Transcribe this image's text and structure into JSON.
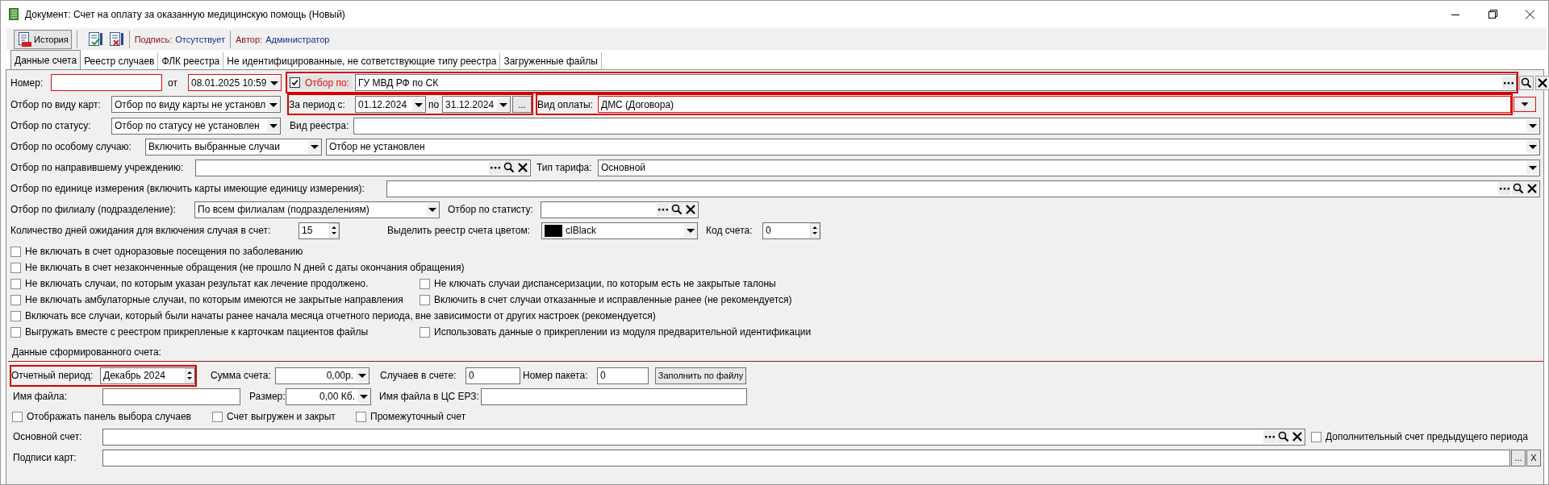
{
  "window": {
    "title": "Документ: Счет на оплату за оказанную медицинскую помощь (Новый)"
  },
  "toolbar": {
    "history_button": "История",
    "signature": {
      "label": "Подпись:",
      "value": "Отсутствует"
    },
    "author": {
      "label": "Автор:",
      "value": "Администратор"
    }
  },
  "tabs": [
    {
      "label": "Данные счета",
      "selected": true
    },
    {
      "label": "Реестр случаев",
      "selected": false
    },
    {
      "label": "ФЛК реестра",
      "selected": false
    },
    {
      "label": "Не идентифицированные, не сответствующие типу реестра",
      "selected": false
    },
    {
      "label": "Загруженные файлы",
      "selected": false
    }
  ],
  "rows": [
    [
      {
        "kind": "label",
        "text": "Номер:"
      },
      {
        "kind": "input",
        "highlighted": true
      },
      {
        "kind": "label",
        "text": "от"
      },
      {
        "kind": "date",
        "value": "08.01.2025 10:59",
        "highlighted": true
      },
      {
        "kind": "group",
        "highlighted": true,
        "items": [
          {
            "kind": "filter-check",
            "label": "Отбор по:",
            "checked": true
          },
          {
            "kind": "picker",
            "value": "ГУ МВД РФ по СК"
          }
        ]
      },
      {
        "kind": "icon-buttons"
      }
    ],
    [
      {
        "kind": "label",
        "text": "Отбор по виду карт:"
      },
      {
        "kind": "combo",
        "value": "Отбор по виду карты не установл"
      },
      {
        "kind": "group",
        "highlighted": true,
        "items": [
          {
            "kind": "label",
            "text": "За период с:"
          },
          {
            "kind": "date",
            "value": "01.12.2024"
          },
          {
            "kind": "label",
            "text": "по"
          },
          {
            "kind": "date",
            "value": "31.12.2024"
          },
          {
            "kind": "button",
            "label": "..."
          }
        ]
      },
      {
        "kind": "group",
        "highlighted": true,
        "items": [
          {
            "kind": "label",
            "text": "Вид оплаты:"
          },
          {
            "kind": "text",
            "value": "ДМС (Договора)",
            "highlighted": true
          }
        ]
      },
      {
        "kind": "arrow"
      }
    ],
    [
      {
        "kind": "label",
        "text": "Отбор по статусу:"
      },
      {
        "kind": "combo",
        "value": "Отбор по статусу не установлен"
      },
      {
        "kind": "label",
        "text": "Вид реестра:"
      },
      {
        "kind": "combo"
      }
    ],
    [
      {
        "kind": "label",
        "text": "Отбор по особому случаю:"
      },
      {
        "kind": "combo",
        "value": "Включить выбранные случаи"
      },
      {
        "kind": "combo",
        "value": "Отбор не установлен"
      }
    ],
    [
      {
        "kind": "label",
        "text": "Отбор по направившему учреждению:"
      },
      {
        "kind": "lookup"
      },
      {
        "kind": "label",
        "text": "Тип тарифа:"
      },
      {
        "kind": "combo",
        "value": "Основной"
      }
    ],
    [
      {
        "kind": "label",
        "text": "Отбор по единице измерения (включить карты имеющие единицу измерения):"
      },
      {
        "kind": "lookup"
      }
    ],
    [
      {
        "kind": "label",
        "text": "Отбор по филиалу (подразделение):"
      },
      {
        "kind": "combo",
        "value": "По всем филиалам (подразделениям)"
      },
      {
        "kind": "label",
        "text": "Отбор по статисту:"
      },
      {
        "kind": "lookup"
      }
    ],
    [
      {
        "kind": "label",
        "text": "Количество дней ожидания для включения случая в счет:"
      },
      {
        "kind": "spin",
        "value": "15"
      },
      {
        "kind": "label",
        "text": "Выделить реестр счета цветом:"
      },
      {
        "kind": "color-combo",
        "value": "clBlack",
        "color": "#000000"
      },
      {
        "kind": "label",
        "text": "Код счета:"
      },
      {
        "kind": "spin",
        "value": "0"
      }
    ]
  ],
  "options": [
    {
      "left": {
        "label": "Не включать в счет одноразовые посещения по заболеванию",
        "checked": false
      }
    },
    {
      "left": {
        "label": "Не включать в счет незаконченные обращения (не прошло N дней с даты окончания обращения)",
        "checked": false
      }
    },
    {
      "left": {
        "label": "Не включать случаи, по которым указан результат как лечение продолжено.",
        "checked": false
      },
      "right": {
        "label": "Не ключать случаи диспансеризации, по которым есть не закрытые талоны",
        "checked": false
      }
    },
    {
      "left": {
        "label": "Не включать амбулаторные случаи, по которым имеются не закрытые направления",
        "checked": false
      },
      "right": {
        "label": "Включить в счет случаи отказанные и исправленные ранее (не рекомендуется)",
        "checked": false
      }
    },
    {
      "left": {
        "label": "Включать все случаи, который были начаты ранее начала месяца отчетного периода, вне зависимости от других настроек (рекомендуется)",
        "checked": false
      }
    },
    {
      "left": {
        "label": "Выгружать вместе с реестром прикрепленые к карточкам пациентов файлы",
        "checked": false
      },
      "right": {
        "label": "Использовать данные о прикреплении из модуля предварительной идентификации",
        "checked": false
      }
    }
  ],
  "section": {
    "title": "Данные сформированного счета:"
  },
  "bottom_rows": [
    [
      {
        "kind": "group",
        "highlighted": true,
        "items": [
          {
            "kind": "label",
            "text": "Отчетный период:"
          },
          {
            "kind": "spin",
            "value": "Декабрь  2024"
          }
        ]
      },
      {
        "kind": "label",
        "text": "Сумма счета:"
      },
      {
        "kind": "amount",
        "value": "0,00р."
      },
      {
        "kind": "label",
        "text": "Случаев в счете:"
      },
      {
        "kind": "text",
        "value": "0"
      },
      {
        "kind": "label",
        "text": "Номер пакета:"
      },
      {
        "kind": "text",
        "value": "0"
      },
      {
        "kind": "button",
        "label": "Заполнить по файлу"
      }
    ],
    [
      {
        "kind": "label",
        "text": "Имя файла:"
      },
      {
        "kind": "input"
      },
      {
        "kind": "label",
        "text": "Размер:"
      },
      {
        "kind": "amount",
        "value": "0,00 Кб."
      },
      {
        "kind": "label",
        "text": "Имя файла в ЦС ЕРЗ:"
      },
      {
        "kind": "input"
      }
    ],
    [
      {
        "kind": "checkbox",
        "label": "Отображать панель выбора случаев",
        "checked": false
      },
      {
        "kind": "checkbox",
        "label": "Счет выгружен и закрыт",
        "checked": false
      },
      {
        "kind": "checkbox",
        "label": "Промежуточный счет",
        "checked": false
      }
    ],
    [
      {
        "kind": "label",
        "text": "Основной счет:"
      },
      {
        "kind": "lookup"
      },
      {
        "kind": "checkbox",
        "label": "Дополнительный счет предыдущего периода",
        "checked": false
      }
    ],
    [
      {
        "kind": "label",
        "text": "Подписи карт:"
      },
      {
        "kind": "input"
      },
      {
        "kind": "button",
        "label": "..."
      },
      {
        "kind": "button",
        "label": "X"
      }
    ]
  ]
}
